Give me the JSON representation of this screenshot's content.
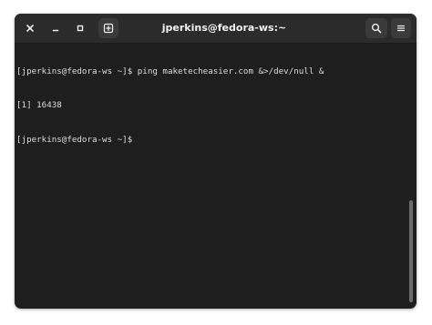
{
  "window": {
    "title": "jperkins@fedora-ws:~"
  },
  "titlebar": {
    "buttons": {
      "close": "close-icon",
      "minimize": "minimize-icon",
      "maximize": "maximize-icon",
      "new_tab": "new-tab-icon",
      "search": "search-icon",
      "menu": "hamburger-menu-icon"
    }
  },
  "terminal": {
    "lines": [
      "[jperkins@fedora-ws ~]$ ping maketecheasier.com &>/dev/null &",
      "[1] 16438",
      "[jperkins@fedora-ws ~]$ "
    ]
  },
  "colors": {
    "background": "#1e1e1e",
    "titlebar": "#2b2b2b",
    "text": "#dcdcdc"
  }
}
